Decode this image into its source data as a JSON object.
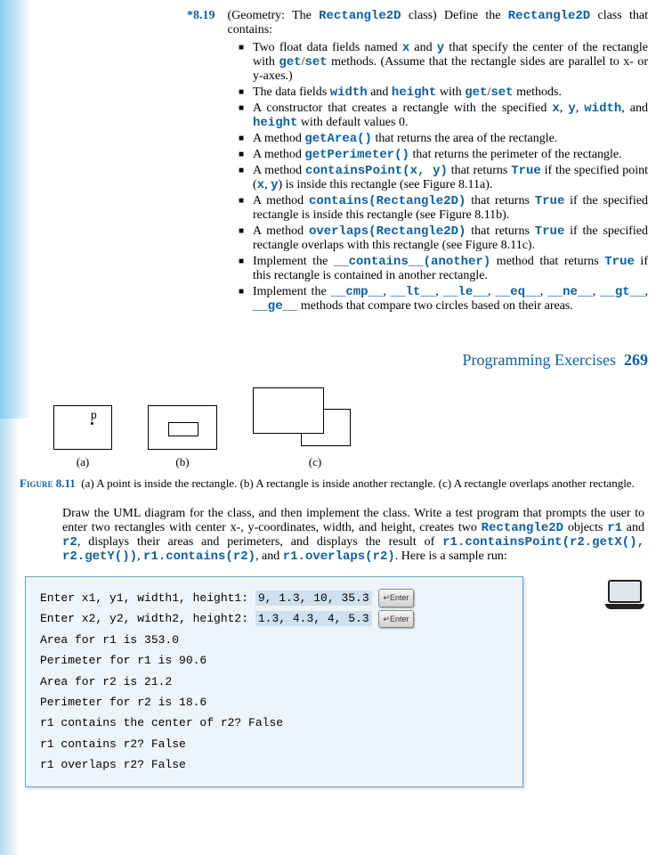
{
  "exercise": {
    "number": "*8.19",
    "title_prefix": "(Geometry: The ",
    "title_class": "Rectangle2D",
    "title_suffix": " class) Define the ",
    "title_class2": "Rectangle2D",
    "title_end": " class that contains:"
  },
  "bullets": {
    "b1a": "Two float data fields named ",
    "b1x": "x",
    "b1b": " and ",
    "b1y": "y",
    "b1c": " that specify the center of the rectangle with ",
    "b1get": "get",
    "b1slash": "/",
    "b1set": "set",
    "b1d": " methods. (Assume that the rectangle sides are parallel to x- or y-axes.)",
    "b2a": "The data fields ",
    "b2w": "width",
    "b2b": " and ",
    "b2h": "height",
    "b2c": " with ",
    "b2get": "get",
    "b2slash": "/",
    "b2set": "set",
    "b2d": " methods.",
    "b3a": "A constructor that creates a rectangle with the specified ",
    "b3x": "x",
    "b3c1": ", ",
    "b3y": "y",
    "b3c2": ", ",
    "b3w": "width",
    "b3c3": ", and ",
    "b3h": "height",
    "b3b": " with default values 0.",
    "b4a": "A method ",
    "b4m": "getArea()",
    "b4b": " that returns the area of the rectangle.",
    "b5a": "A method ",
    "b5m": "getPerimeter()",
    "b5b": " that returns the perimeter of the rectangle.",
    "b6a": "A method ",
    "b6m": "containsPoint(x, y)",
    "b6b": " that returns ",
    "b6t": "True",
    "b6c": " if the specified point (",
    "b6x": "x",
    "b6d": ", ",
    "b6y": "y",
    "b6e": ") is inside this rectangle (see Figure 8.11a).",
    "b7a": "A method ",
    "b7m": "contains(Rectangle2D)",
    "b7b": " that returns ",
    "b7t": "True",
    "b7c": " if the specified rectangle is inside this rectangle (see Figure 8.11b).",
    "b8a": "A method ",
    "b8m": "overlaps(Rectangle2D)",
    "b8b": " that returns ",
    "b8t": "True",
    "b8c": " if the specified rectangle overlaps with this rectangle (see Figure 8.11c).",
    "b9a": "Implement the ",
    "b9m": "__contains__(another)",
    "b9b": " method that returns ",
    "b9t": "True",
    "b9c": " if this rectangle is contained in another rectangle.",
    "b10a": "Implement the ",
    "b10_cmp": "__cmp__",
    "c1": ", ",
    "b10_lt": "__lt__",
    "c2": ", ",
    "b10_le": "__le__",
    "c3": ", ",
    "b10_eq": "__eq__",
    "c4": ", ",
    "b10_ne": "__ne__",
    "c5": ", ",
    "b10_gt": "__gt__",
    "c6": ", ",
    "b10_ge": "__ge__",
    "b10b": " methods that compare two circles based on their areas."
  },
  "header": {
    "section": "Programming Exercises",
    "page": "269"
  },
  "figure": {
    "p": "p",
    "la": "(a)",
    "lb": "(b)",
    "lc": "(c)",
    "label": "Figure 8.11",
    "caption": "(a) A point is inside the rectangle. (b) A rectangle is inside another rectangle. (c) A rectangle overlaps another rectangle."
  },
  "para": {
    "p1a": "Draw the UML diagram for the class, and then implement the class. Write a test program that prompts the user to enter two rectangles with center x-, y-coordinates, width, and height, creates two ",
    "p1cls": "Rectangle2D",
    "p1b": " objects ",
    "p1r1": "r1",
    "p1c": " and ",
    "p1r2": "r2",
    "p1d": ", displays their areas and perimeters, and displays the result of ",
    "p1m1": "r1.containsPoint(r2.getX(), r2.getY())",
    "p1e": ", ",
    "p1m2": "r1.contains(r2)",
    "p1f": ", and ",
    "p1m3": "r1.overlaps(r2)",
    "p1g": ". Here is a sample run:"
  },
  "run": {
    "l1a": "Enter x1, y1, width1, height1: ",
    "l1b": "9, 1.3, 10, 35.3",
    "enter": "↵Enter",
    "l2a": "Enter x2, y2, width2, height2: ",
    "l2b": "1.3, 4.3, 4, 5.3",
    "l3": "Area for r1 is 353.0",
    "l4": "Perimeter for r1 is 90.6",
    "l5": "Area for r2 is 21.2",
    "l6": "Perimeter for r2 is 18.6",
    "l7": "r1 contains the center of r2? False",
    "l8": "r1 contains r2? False",
    "l9": "r1 overlaps r2? False"
  }
}
